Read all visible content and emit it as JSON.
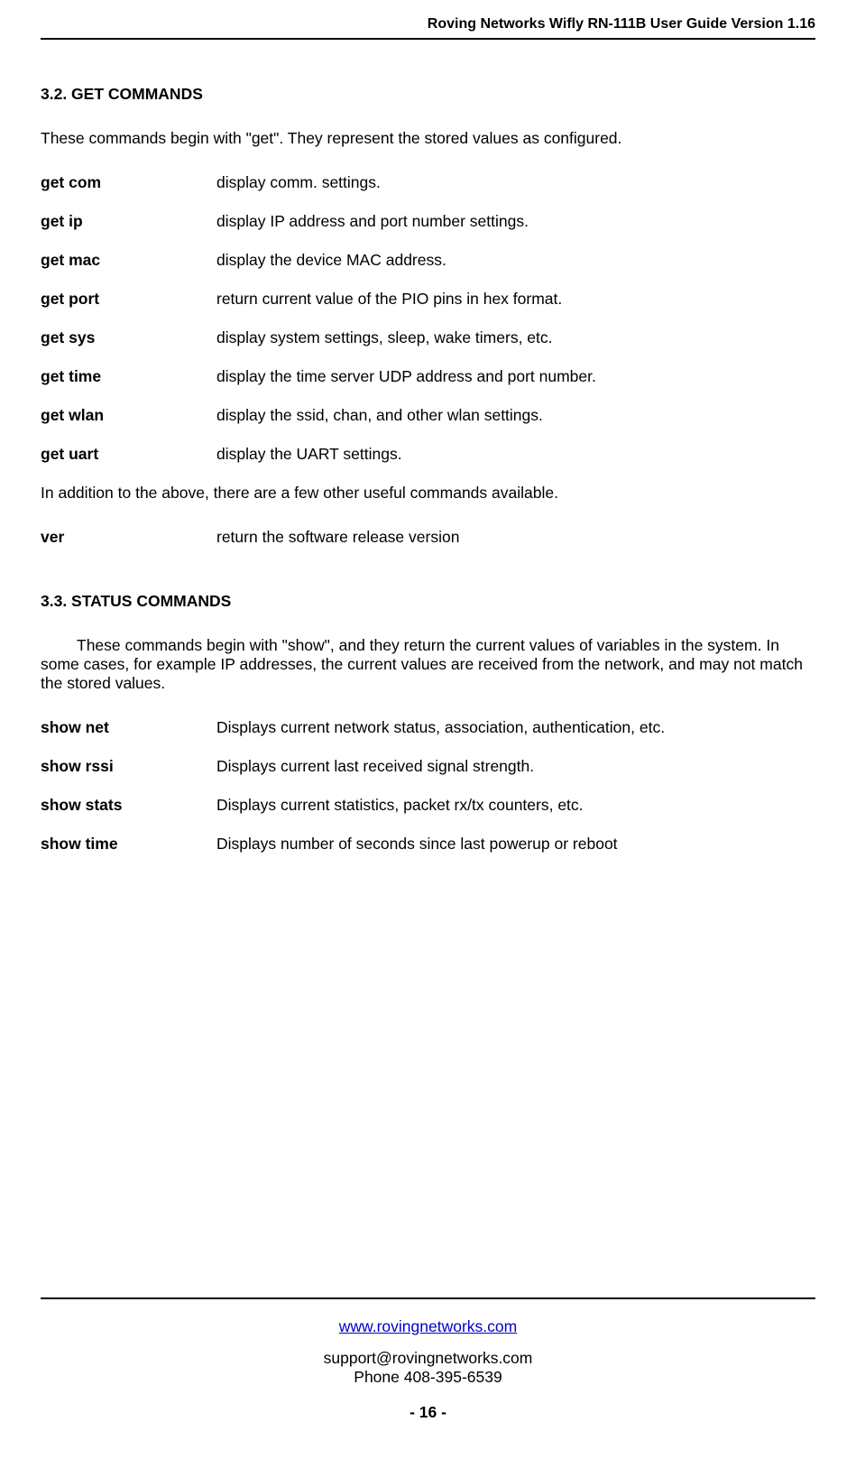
{
  "header": {
    "title": "Roving Networks Wifly  RN-111B User Guide  Version 1.16"
  },
  "sections": {
    "get_commands": {
      "heading": "3.2.    GET COMMANDS",
      "intro": "These commands begin with \"get\".  They represent the stored values as configured.",
      "rows": [
        {
          "cmd": "get com",
          "desc": "display comm. settings."
        },
        {
          "cmd": "get ip",
          "desc": "display IP address and port number settings."
        },
        {
          "cmd": "get mac",
          "desc": "display the device MAC address."
        },
        {
          "cmd": "get port",
          "desc": "return current value of the PIO pins in hex format."
        },
        {
          "cmd": "get sys",
          "desc": "display system settings, sleep, wake timers, etc."
        },
        {
          "cmd": "get time",
          "desc": "display the time server UDP address and port number."
        },
        {
          "cmd": "get wlan",
          "desc": "display the ssid, chan, and other wlan settings."
        },
        {
          "cmd": "get uart",
          "desc": "display the UART settings."
        }
      ],
      "addendum": "In addition to the above, there are a few other useful commands available.",
      "extra_rows": [
        {
          "cmd": "ver",
          "desc": "return the software release version"
        }
      ]
    },
    "status_commands": {
      "heading": "3.3.    STATUS COMMANDS",
      "intro": "These commands begin with \"show\",  and they return the current values of variables in the system.   In some cases,  for example IP addresses,  the current values are received from the network, and may not match the stored values.",
      "rows": [
        {
          "cmd": "show  net",
          "desc": "Displays current network status, association, authentication, etc."
        },
        {
          "cmd": "show  rssi",
          "desc": "Displays current last received signal strength."
        },
        {
          "cmd": "show  stats",
          "desc": "Displays current statistics,  packet rx/tx counters, etc."
        },
        {
          "cmd": "show  time",
          "desc": "Displays number of seconds since last powerup or reboot"
        }
      ]
    }
  },
  "footer": {
    "url": "www.rovingnetworks.com",
    "email": "support@rovingnetworks.com",
    "phone": "Phone 408-395-6539",
    "page": "- 16 -"
  }
}
